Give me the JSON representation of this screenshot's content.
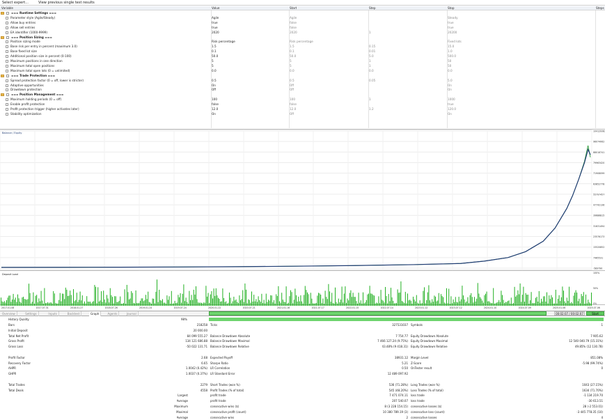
{
  "toolbar": {
    "expert": "Select expert...",
    "view": "View previous single test results"
  },
  "params": {
    "headers": [
      "Variable",
      "Value",
      "Start",
      "Step",
      "Stop",
      "Steps"
    ],
    "rows": [
      {
        "kind": "group",
        "label": "=== Runtime Settings ==="
      },
      {
        "kind": "item",
        "label": "Parameter style (Agile/Steady)",
        "value": "Agile",
        "start": "Agile",
        "step": "",
        "stop": "Steady"
      },
      {
        "kind": "item",
        "label": "Allow buy entries",
        "value": "true",
        "start": "false",
        "step": "",
        "stop": "true"
      },
      {
        "kind": "item",
        "label": "Allow sell entries",
        "value": "true",
        "start": "false",
        "step": "",
        "stop": "true"
      },
      {
        "kind": "item",
        "label": "EA identifier (1000-9999)",
        "value": "2020",
        "start": "2020",
        "step": "1",
        "stop": "20200"
      },
      {
        "kind": "group",
        "label": "=== Position Sizing ==="
      },
      {
        "kind": "item",
        "label": "Position sizing mode",
        "value": "Risk percentage",
        "start": "Risk percentage",
        "step": "",
        "stop": "Fixed lots"
      },
      {
        "kind": "item",
        "label": "Base risk per entry in percent (maximum 3.0)",
        "value": "1.5",
        "start": "1.5",
        "step": "0.15",
        "stop": "15.0"
      },
      {
        "kind": "item",
        "label": "Base fixed lot size",
        "value": "0.1",
        "start": "0.1",
        "step": "0.01",
        "stop": "1.0"
      },
      {
        "kind": "item",
        "label": "Additional position size in percent (0-100)",
        "value": "50.0",
        "start": "50.0",
        "step": "5.0",
        "stop": "500.0"
      },
      {
        "kind": "item",
        "label": "Maximum positions in one direction",
        "value": "5",
        "start": "5",
        "step": "1",
        "stop": "50"
      },
      {
        "kind": "item",
        "label": "Maximum total open positions",
        "value": "5",
        "start": "5",
        "step": "1",
        "stop": "50"
      },
      {
        "kind": "item",
        "label": "Maximum total open lots (0 = unlimited)",
        "value": "0.0",
        "start": "0.0",
        "step": "0.0",
        "stop": "0.0"
      },
      {
        "kind": "group",
        "label": "=== Trade Protection ==="
      },
      {
        "kind": "item",
        "label": "Spread protection factor (0 = off, lower is stricter)",
        "value": "0.5",
        "start": "0.5",
        "step": "0.05",
        "stop": "5.0"
      },
      {
        "kind": "item",
        "label": "Adaptive opportunities",
        "value": "On",
        "start": "Off",
        "step": "",
        "stop": "On"
      },
      {
        "kind": "item",
        "label": "Drawdown protection",
        "value": "Off",
        "start": "Off",
        "step": "",
        "stop": "On"
      },
      {
        "kind": "group",
        "label": "=== Position Management ==="
      },
      {
        "kind": "item",
        "label": "Maximum holding periods (0 = off)",
        "value": "100",
        "start": "100",
        "step": "1",
        "stop": "1000"
      },
      {
        "kind": "item",
        "label": "Enable profit protection",
        "value": "false",
        "start": "false",
        "step": "",
        "stop": "true"
      },
      {
        "kind": "item",
        "label": "Profit protection trigger (higher activates later)",
        "value": "12.0",
        "start": "12.0",
        "step": "1.2",
        "stop": "120.0"
      },
      {
        "kind": "item",
        "label": "Stability optimization",
        "value": "On",
        "start": "Off",
        "step": "",
        "stop": "On"
      }
    ]
  },
  "chart": {
    "legend": "Balance / Equity",
    "deposit_label": "Deposit Load",
    "yticks": [
      "104129383",
      "96074062",
      "88018741",
      "79963420",
      "71908099",
      "63852778",
      "55797457",
      "47742136",
      "39686815",
      "31631494",
      "23576173",
      "15520852",
      "7465531",
      "-589790"
    ],
    "dep_ticks": [
      "100%",
      "50%",
      "0%"
    ],
    "xticks": [
      "2017.01.08",
      "2017.07.31",
      "2018.01.27",
      "2018.07.26",
      "2019.01.24",
      "2019.07.24",
      "2020.01.22",
      "2020.07.21",
      "2021.01.16",
      "2021.07.17",
      "2022.01.15",
      "2022.07.14",
      "2023.01.12",
      "2023.07.12",
      "2024.01.10",
      "2024.07.09",
      "2025.01.06",
      "2025.07.06"
    ],
    "balance_color": "#1f3b73",
    "equity_color": "#2e9e3a",
    "deposit_color": "#22b022"
  },
  "chart_data": {
    "type": "line",
    "x": [
      0,
      10,
      20,
      30,
      40,
      50,
      60,
      70,
      78,
      82,
      86,
      89,
      92,
      94,
      96,
      97,
      98,
      99,
      99.6,
      100
    ],
    "series": [
      {
        "name": "Balance",
        "values": [
          20000,
          60000,
          150000,
          300000,
          550000,
          900000,
          1400000,
          2100000,
          3000000,
          4800000,
          7500000,
          12000000,
          20000000,
          30000000,
          45000000,
          55000000,
          67000000,
          80000000,
          90000000,
          86000000
        ]
      },
      {
        "name": "Equity",
        "values": [
          20000,
          60000,
          150000,
          300000,
          550000,
          900000,
          1400000,
          2100000,
          3000000,
          4800000,
          7500000,
          12000000,
          20000000,
          30000000,
          45000000,
          55000000,
          67000000,
          81000000,
          93000000,
          84000000
        ]
      }
    ],
    "ylim": [
      -589790,
      104129383
    ]
  },
  "tabs": [
    "Overview",
    "Settings",
    "Inputs",
    "Backtest",
    "Graph",
    "Agents",
    "Journal"
  ],
  "progress": {
    "time": "00:02:07 / 00:02:07",
    "start": "Start",
    "fraction": 1.0
  },
  "report": {
    "history_quality": {
      "label": "History Quality",
      "value": "98%"
    },
    "rows": [
      {
        "c": [
          "Bars",
          "218258",
          "Ticks",
          "327531037",
          "Symbols",
          "1"
        ]
      },
      {
        "c": [
          "Initial Deposit",
          "20 000.00",
          "",
          "",
          "",
          ""
        ]
      },
      {
        "c": [
          "Total Net Profit",
          "84 099 555.27",
          "Balance Drawdown Absolute",
          "7 754.77",
          "Equity Drawdown Absolute",
          "7 905.62"
        ]
      },
      {
        "c": [
          "Gross Profit",
          "134 121 686.88",
          "Balance Drawdown Maximal",
          "7 466 127.24 (9.75%)",
          "Equity Drawdown Maximal",
          "12 540 040.79 (15.31%)"
        ]
      },
      {
        "c": [
          "Gross Loss",
          "-50 022 131.71",
          "Balance Drawdown Relative",
          "43.48% (9 418.31)",
          "Equity Drawdown Relative",
          "49.85% (12 130.78)"
        ]
      },
      {
        "c": [
          "",
          "",
          "",
          "",
          "",
          ""
        ]
      },
      {
        "c": [
          "Profit Factor",
          "2.68",
          "Expected Payoff",
          "38931.12",
          "Margin Level",
          "851.08%"
        ]
      },
      {
        "c": [
          "Recovery Factor",
          "6.65",
          "Sharpe Ratio",
          "5.21",
          "Z-Score",
          "-5.98 (99.74%)"
        ]
      },
      {
        "c": [
          "AHPR",
          "1.0042 (0.42%)",
          "LR Correlation",
          "0.50",
          "OnTester result",
          "0"
        ]
      },
      {
        "c": [
          "GHPR",
          "1.0037 (0.37%)",
          "LR Standard Error",
          "12 489 097.92",
          "",
          ""
        ]
      },
      {
        "c": [
          "",
          "",
          "",
          "",
          "",
          ""
        ]
      },
      {
        "c": [
          "Total Trades",
          "2279",
          "Short Trades (won %)",
          "536 (71.28%)",
          "Long Trades (won %)",
          "1043 (27.15%)"
        ]
      },
      {
        "c": [
          "Total Deals",
          "4558",
          "Profit Trades (% of total)",
          "545 (48.20%)",
          "Loss Trades (% of total)",
          "1634 (71.70%)"
        ]
      },
      {
        "c": [
          "Largest",
          "",
          "profit trade",
          "7 471 074.11",
          "loss trade",
          "-1 134 219.70"
        ]
      },
      {
        "c": [
          "Average",
          "",
          "profit trade",
          "207 540.07",
          "loss trade",
          "-30 613.51"
        ]
      },
      {
        "c": [
          "Maximum",
          "",
          "consecutive wins ($)",
          "8 (3 228 154.15)",
          "consecutive losses ($)",
          "28 (-2 553.01)"
        ]
      },
      {
        "c": [
          "Maximal",
          "",
          "consecutive profit (count)",
          "10 380 789.19 (3)",
          "consecutive loss (count)",
          "-3 445 778.35 (10)"
        ]
      },
      {
        "c": [
          "Average",
          "",
          "consecutive wins",
          "2",
          "consecutive losses",
          "4"
        ]
      }
    ]
  }
}
